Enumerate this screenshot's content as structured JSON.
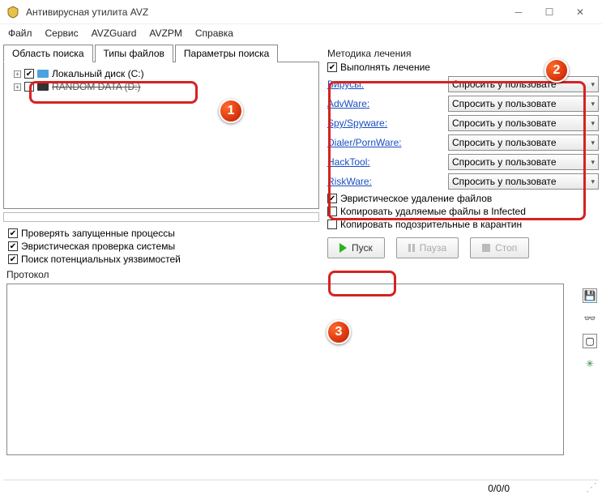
{
  "window": {
    "title": "Антивирусная утилита AVZ"
  },
  "menu": {
    "file": "Файл",
    "service": "Сервис",
    "avzguard": "AVZGuard",
    "avzpm": "AVZPM",
    "help": "Справка"
  },
  "tabs": {
    "scan_area": "Область поиска",
    "file_types": "Типы файлов",
    "search_params": "Параметры поиска"
  },
  "tree": {
    "drive_c": "Локальный диск (C:)",
    "drive_d": "RANDOM DATA (D:)"
  },
  "left_checks": {
    "running_processes": "Проверять запущенные процессы",
    "heuristic_system": "Эвристическая проверка системы",
    "vuln_search": "Поиск потенциальных уязвимостей"
  },
  "cure": {
    "group": "Методика лечения",
    "perform": "Выполнять лечение",
    "dropdown_value": "Спросить у пользовате",
    "rows": {
      "viruses": "Вирусы:",
      "advware": "AdvWare:",
      "spyware": "Spy/Spyware:",
      "dialer": "Dialer/PornWare:",
      "hacktool": "HackTool:",
      "riskware": "RiskWare:"
    },
    "heur_delete": "Эвристическое удаление файлов",
    "copy_infected": "Копировать удаляемые файлы в Infected",
    "copy_quarantine": "Копировать подозрительные в карантин"
  },
  "buttons": {
    "start": "Пуск",
    "pause": "Пауза",
    "stop": "Стоп"
  },
  "protocol": {
    "label": "Протокол"
  },
  "status": {
    "counters": "0/0/0"
  },
  "badges": {
    "one": "1",
    "two": "2",
    "three": "3"
  }
}
